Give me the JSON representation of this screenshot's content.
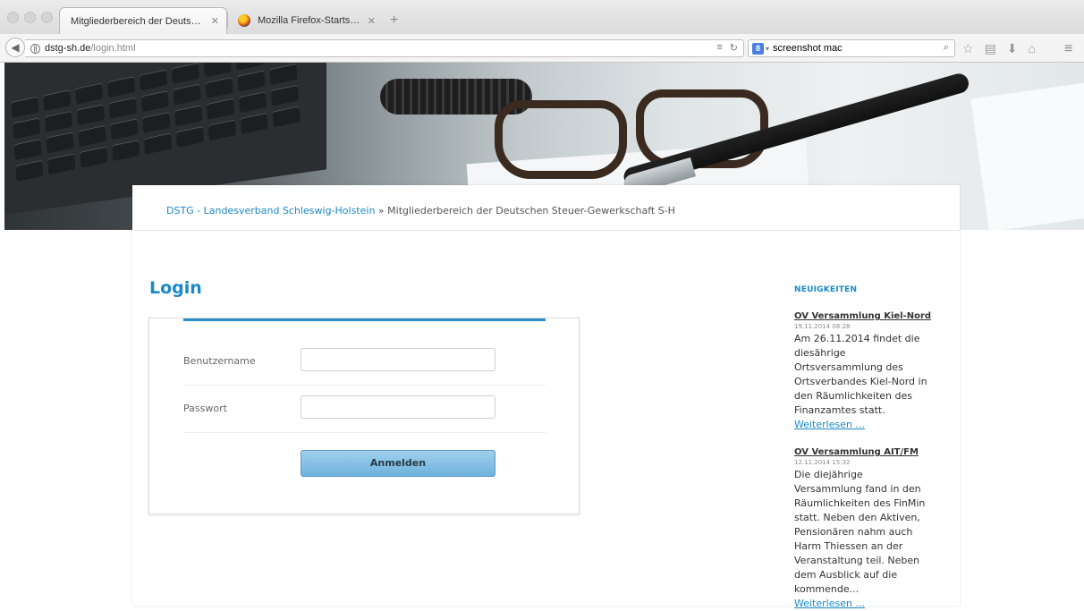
{
  "browser": {
    "tabs": [
      {
        "title": "Mitgliederbereich der Deutschen ...",
        "active": true
      },
      {
        "title": "Mozilla Firefox-Startseite",
        "active": false
      }
    ],
    "new_tab": "+",
    "url_host": "dstg-sh.de",
    "url_path": "/login.html",
    "search_value": "screenshot mac",
    "search_engine_icon": "8"
  },
  "page": {
    "breadcrumb": {
      "home_link": "DSTG - Landesverband Schleswig-Holstein",
      "separator": " » ",
      "current": "Mitgliederbereich der Deutschen Steuer-Gewerkschaft S-H"
    },
    "login": {
      "title": "Login",
      "username_label": "Benutzername",
      "username_value": "",
      "password_label": "Passwort",
      "password_value": "",
      "submit_label": "Anmelden"
    },
    "news": {
      "heading": "NEUIGKEITEN",
      "items": [
        {
          "title": "OV Versammlung Kiel-Nord",
          "date": "19.11.2014 08:28",
          "body": "Am 26.11.2014 findet die diesährige Ortsversammlung des Ortsverbandes Kiel-Nord in den Räumlichkeiten des Finanzamtes statt.",
          "more": "Weiterlesen ..."
        },
        {
          "title": "OV Versammlung AIT/FM",
          "date": "12.11.2014 15:32",
          "body": "Die diejährige Versammlung fand in den Räumlichkeiten des FinMin statt. Neben den Aktiven, Pensionären nahm auch Harm Thiessen an der Veranstaltung teil. Neben dem Ausblick auf die kommende...",
          "more": "Weiterlesen ..."
        }
      ]
    }
  },
  "colors": {
    "accent": "#1a8ac6",
    "button_top": "#9fd0ec",
    "button_bottom": "#6fb2dc"
  }
}
